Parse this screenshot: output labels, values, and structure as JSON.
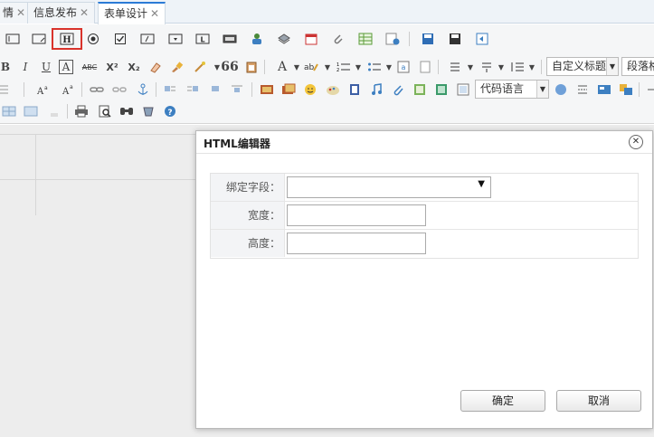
{
  "tabs": [
    {
      "label": "情",
      "close": "✕"
    },
    {
      "label": "信息发布",
      "close": "✕"
    },
    {
      "label": "表单设计",
      "close": "✕"
    }
  ],
  "toolbar": {
    "text_btn_b": "B",
    "text_btn_i": "I",
    "text_btn_u": "U",
    "text_btn_a": "A",
    "text_btn_abc": "ABC",
    "superscript": "X²",
    "subscript": "X₂",
    "quote": "66",
    "font_color": "A",
    "custom_title_combo": "自定义标题",
    "paragraph_combo": "段落格",
    "code_lang_combo": "代码语言",
    "html_icon_label": "H"
  },
  "dialog": {
    "title": "HTML编辑器",
    "close_glyph": "✕",
    "fields": {
      "bind_label": "绑定字段：",
      "width_label": "宽度：",
      "height_label": "高度："
    },
    "bind_value": "",
    "width_value": "",
    "height_value": "",
    "ok_label": "确定",
    "cancel_label": "取消"
  }
}
